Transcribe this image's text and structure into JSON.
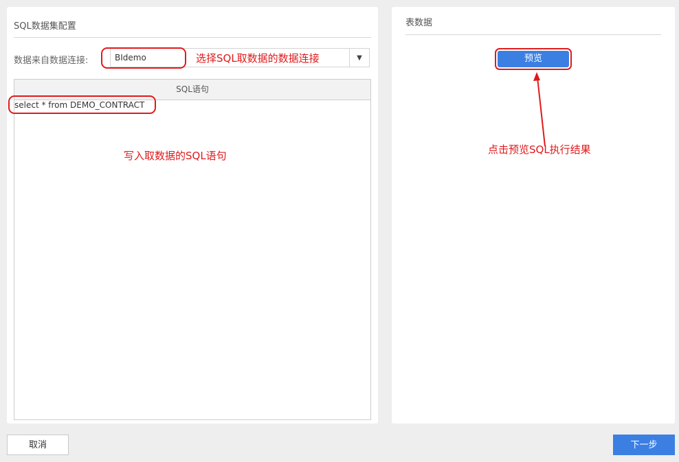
{
  "left_panel": {
    "title": "SQL数据集配置",
    "connection_label": "数据来自数据连接:",
    "connection_value": "BIdemo",
    "sql_header": "SQL语句",
    "sql_text": "select * from DEMO_CONTRACT"
  },
  "right_panel": {
    "title": "表数据",
    "preview_label": "预览"
  },
  "annotations": {
    "select_connection": "选择SQL取数据的数据连接",
    "write_sql": "写入取数据的SQL语句",
    "click_preview": "点击预览SQL执行结果"
  },
  "footer": {
    "cancel_label": "取消",
    "next_label": "下一步"
  },
  "icons": {
    "dropdown": "caret-down-icon",
    "arrow": "arrow-up-annotation-icon"
  },
  "colors": {
    "primary": "#3b7fe3",
    "annotation": "#e0191b",
    "background": "#eeeeee"
  }
}
